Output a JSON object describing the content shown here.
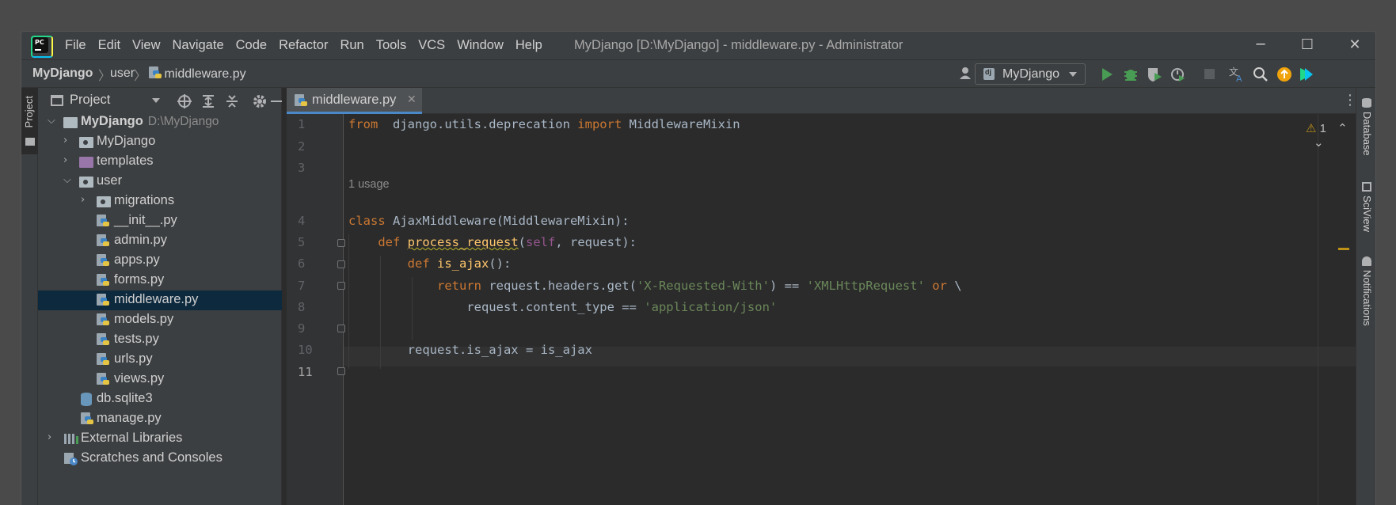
{
  "window": {
    "title": "MyDjango [D:\\MyDjango] - middleware.py - Administrator",
    "menu": [
      "File",
      "Edit",
      "View",
      "Navigate",
      "Code",
      "Refactor",
      "Run",
      "Tools",
      "VCS",
      "Window",
      "Help"
    ]
  },
  "nav": {
    "breadcrumb": [
      "MyDjango",
      "user",
      "middleware.py"
    ],
    "run_config": "MyDjango"
  },
  "left_stripe": {
    "project_label": "Project"
  },
  "project_panel": {
    "title": "Project",
    "tree": [
      {
        "label": "MyDjango",
        "path": "D:\\MyDjango",
        "type": "root-folder",
        "expanded": true
      },
      {
        "label": "MyDjango",
        "type": "package",
        "expanded": false
      },
      {
        "label": "templates",
        "type": "templates-folder",
        "expanded": false
      },
      {
        "label": "user",
        "type": "package",
        "expanded": true
      },
      {
        "label": "migrations",
        "type": "package",
        "expanded": false
      },
      {
        "label": "__init__.py",
        "type": "python-file"
      },
      {
        "label": "admin.py",
        "type": "python-file"
      },
      {
        "label": "apps.py",
        "type": "python-file"
      },
      {
        "label": "forms.py",
        "type": "python-file"
      },
      {
        "label": "middleware.py",
        "type": "python-file",
        "selected": true
      },
      {
        "label": "models.py",
        "type": "python-file"
      },
      {
        "label": "tests.py",
        "type": "python-file"
      },
      {
        "label": "urls.py",
        "type": "python-file"
      },
      {
        "label": "views.py",
        "type": "python-file"
      },
      {
        "label": "db.sqlite3",
        "type": "database-file"
      },
      {
        "label": "manage.py",
        "type": "python-file"
      },
      {
        "label": "External Libraries",
        "type": "libraries",
        "expanded": false
      },
      {
        "label": "Scratches and Consoles",
        "type": "scratches"
      }
    ]
  },
  "editor": {
    "tab": "middleware.py",
    "inspections": "1",
    "usage_hint": "1 usage",
    "current_line": "11",
    "lines": [
      {
        "n": "1",
        "tokens": [
          [
            "kw",
            "from"
          ],
          [
            "",
            "  django.utils.deprecation "
          ],
          [
            "kw",
            "import"
          ],
          [
            "",
            " MiddlewareMixin"
          ]
        ]
      },
      {
        "n": "2",
        "tokens": []
      },
      {
        "n": "3",
        "tokens": []
      },
      {
        "n": "4",
        "tokens": [
          [
            "kw",
            "class"
          ],
          [
            "",
            " AjaxMiddleware(MiddlewareMixin):"
          ]
        ]
      },
      {
        "n": "5",
        "tokens": [
          [
            "",
            "    "
          ],
          [
            "kw",
            "def"
          ],
          [
            "",
            " "
          ],
          [
            "fn warn-u",
            "process_request"
          ],
          [
            "",
            "("
          ],
          [
            "self",
            "self"
          ],
          [
            "",
            ", request):"
          ]
        ]
      },
      {
        "n": "6",
        "tokens": [
          [
            "",
            "        "
          ],
          [
            "kw",
            "def"
          ],
          [
            "",
            " "
          ],
          [
            "fn",
            "is_ajax"
          ],
          [
            "",
            "():"
          ]
        ]
      },
      {
        "n": "7",
        "tokens": [
          [
            "",
            "            "
          ],
          [
            "kw",
            "return"
          ],
          [
            "",
            " request.headers.get("
          ],
          [
            "str",
            "'X-Requested-With'"
          ],
          [
            "",
            ") == "
          ],
          [
            "str",
            "'XMLHttpRequest'"
          ],
          [
            "",
            " "
          ],
          [
            "kw",
            "or"
          ],
          [
            "",
            " \\"
          ]
        ]
      },
      {
        "n": "8",
        "tokens": [
          [
            "",
            "                request.content_type == "
          ],
          [
            "str",
            "'application/json'"
          ]
        ]
      },
      {
        "n": "9",
        "tokens": []
      },
      {
        "n": "10",
        "tokens": [
          [
            "",
            "        request.is_ajax = is_ajax"
          ]
        ]
      },
      {
        "n": "11",
        "tokens": []
      }
    ]
  },
  "right_stripe": [
    "Database",
    "SciView",
    "Notifications"
  ],
  "colors": {
    "accent": "#4a88c7",
    "selection": "#0d293e",
    "keyword": "#cc7832",
    "string": "#6a8759"
  }
}
